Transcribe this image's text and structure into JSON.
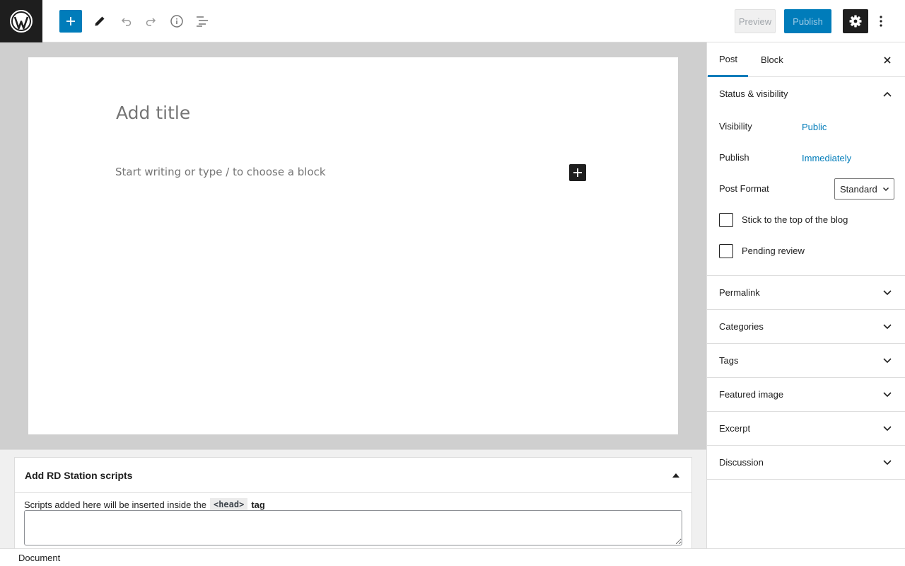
{
  "toolbar": {
    "logo_icon": "wordpress-logo-icon",
    "add_block_icon": "plus-icon",
    "edit_icon": "pencil-icon",
    "undo_icon": "undo-icon",
    "redo_icon": "redo-icon",
    "info_icon": "info-icon",
    "outline_icon": "list-view-icon",
    "preview_label": "Preview",
    "publish_label": "Publish",
    "settings_icon": "gear-icon",
    "more_icon": "more-vertical-icon"
  },
  "editor": {
    "title_placeholder": "Add title",
    "body_placeholder": "Start writing or type / to choose a block"
  },
  "metabox": {
    "title": "Add RD Station scripts",
    "desc_before": "Scripts added here will be inserted inside the",
    "code_tag": "<head>",
    "desc_after": "tag",
    "textarea_value": ""
  },
  "footer": {
    "breadcrumb": "Document"
  },
  "sidebar": {
    "tabs": [
      {
        "label": "Post",
        "active": true
      },
      {
        "label": "Block",
        "active": false
      }
    ],
    "status_panel": {
      "title": "Status & visibility",
      "visibility_label": "Visibility",
      "visibility_value": "Public",
      "publish_label": "Publish",
      "publish_value": "Immediately",
      "format_label": "Post Format",
      "format_value": "Standard",
      "sticky_label": "Stick to the top of the blog",
      "pending_label": "Pending review"
    },
    "panels": [
      {
        "label": "Permalink"
      },
      {
        "label": "Categories"
      },
      {
        "label": "Tags"
      },
      {
        "label": "Featured image"
      },
      {
        "label": "Excerpt"
      },
      {
        "label": "Discussion"
      }
    ]
  },
  "colors": {
    "accent": "#007cba",
    "dark": "#1e1e1e",
    "canvas_bg": "#cfcfcf"
  }
}
